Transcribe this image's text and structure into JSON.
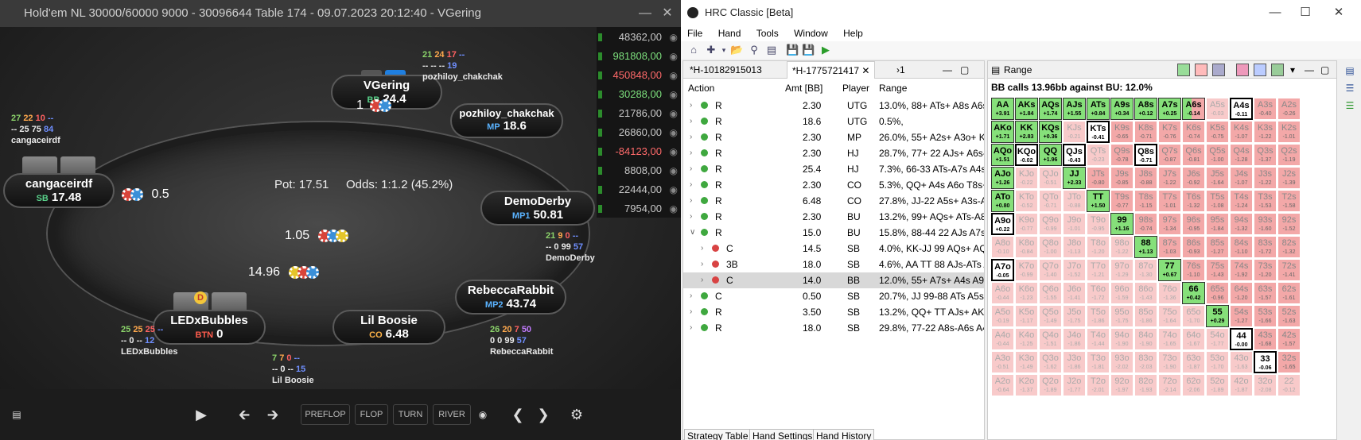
{
  "poker": {
    "title": "Hold'em NL 30000/60000 9000 - 30096644 Table 174 - 09.07.2023 20:12:40 - VGering",
    "pot": "Pot:  17.51",
    "odds": "Odds:  1:1.2 (45.2%)",
    "hero_cards": [
      "K",
      "7"
    ],
    "seats": {
      "vgering": {
        "name": "VGering",
        "pos": "BB",
        "stack": "24.4"
      },
      "pozhiloy": {
        "name": "pozhiloy_chakchak",
        "pos": "MP",
        "stack": "18.6"
      },
      "demoderby": {
        "name": "DemoDerby",
        "pos": "MP1",
        "stack": "50.81"
      },
      "rebecca": {
        "name": "RebeccaRabbit",
        "pos": "MP2",
        "stack": "43.74"
      },
      "boosie": {
        "name": "Lil Boosie",
        "pos": "CO",
        "stack": "6.48"
      },
      "ledx": {
        "name": "LEDxBubbles",
        "pos": "BTN",
        "stack": "0"
      },
      "cang": {
        "name": "cangaceirdf",
        "pos": "SB",
        "stack": "17.48"
      }
    },
    "bets": {
      "vgering": "1",
      "cang": "0.5",
      "center": "1.05",
      "ledx": "14.96"
    },
    "stats": {
      "pozhiloy": {
        "a": "21",
        "b": "24",
        "c": "17",
        "d": "--",
        "e": "-- --",
        "f": "--",
        "g": "19",
        "name": "pozhiloy_chakchak"
      },
      "cang": {
        "a": "27",
        "b": "22",
        "c": "10",
        "d": "--",
        "e": "-- 25",
        "f": "75",
        "g": "84",
        "name": "cangaceirdf"
      },
      "demoderby": {
        "a": "21",
        "b": "9",
        "c": "0",
        "d": "--",
        "e": "-- 0",
        "f": "99",
        "g": "57",
        "name": "DemoDerby"
      },
      "rebecca": {
        "a": "26",
        "b": "20",
        "c": "7",
        "d": "50",
        "e": "0 0",
        "f": "99",
        "g": "57",
        "name": "RebeccaRabbit"
      },
      "ledx": {
        "a": "25",
        "b": "25",
        "c": "25",
        "d": "--",
        "e": "-- 0",
        "f": "--",
        "g": "12",
        "name": "LEDxBubbles"
      },
      "boosie": {
        "a": "7",
        "b": "7",
        "c": "0",
        "d": "--",
        "e": "-- 0",
        "f": "--",
        "g": "15",
        "name": "Lil Boosie"
      }
    },
    "results": [
      "48362,00",
      "981808,00",
      "450848,00",
      "30288,00",
      "21786,00",
      "26860,00",
      "-84123,00",
      "8808,00",
      "22444,00",
      "7954,00"
    ],
    "results_colors": [
      "#c8c8c8",
      "#7de07d",
      "#ff6a6a",
      "#7de07d",
      "#c8c8c8",
      "#c8c8c8",
      "#ff6a6a",
      "#c8c8c8",
      "#c8c8c8",
      "#c8c8c8"
    ],
    "controls": {
      "preflop": "PREFLOP",
      "flop": "FLOP",
      "turn": "TURN",
      "river": "RIVER"
    },
    "dealer_button": "D"
  },
  "hrc": {
    "title": "HRC Classic [Beta]",
    "menu": [
      "File",
      "Hand",
      "Tools",
      "Window",
      "Help"
    ],
    "tabs": [
      "*H-10182915013",
      "*H-1775721417",
      "›1"
    ],
    "range_tab": "Range",
    "columns": {
      "action": "Action",
      "amt": "Amt [BB]",
      "player": "Player",
      "range": "Range"
    },
    "rows": [
      {
        "act": "R",
        "amt": "2.30",
        "pl": "UTG",
        "rng": "13.0%, 88+ ATs+ A8s A6s-A",
        "dot": "g",
        "indent": 0
      },
      {
        "act": "R",
        "amt": "18.6",
        "pl": "UTG",
        "rng": "0.5%,",
        "dot": "g",
        "indent": 0
      },
      {
        "act": "R",
        "amt": "2.30",
        "pl": "MP",
        "rng": "26.0%, 55+ A2s+ A3o+ K9s",
        "dot": "g",
        "indent": 0
      },
      {
        "act": "R",
        "amt": "2.30",
        "pl": "HJ",
        "rng": "28.7%, 77+ 22 AJs+ A6s-A5",
        "dot": "g",
        "indent": 0
      },
      {
        "act": "R",
        "amt": "25.4",
        "pl": "HJ",
        "rng": "7.3%, 66-33 ATs-A7s A4s-A",
        "dot": "g",
        "indent": 0
      },
      {
        "act": "R",
        "amt": "2.30",
        "pl": "CO",
        "rng": "5.3%, QQ+ A4s A6o T8s+ 9",
        "dot": "g",
        "indent": 0
      },
      {
        "act": "R",
        "amt": "6.48",
        "pl": "CO",
        "rng": "27.8%, JJ-22 A5s+ A3s-A2s",
        "dot": "g",
        "indent": 0
      },
      {
        "act": "R",
        "amt": "2.30",
        "pl": "BU",
        "rng": "13.2%, 99+ AQs+ ATs-A8s /",
        "dot": "g",
        "indent": 0
      },
      {
        "act": "R",
        "amt": "15.0",
        "pl": "BU",
        "rng": "15.8%, 88-44 22 AJs A7s-A2",
        "dot": "g",
        "indent": 0,
        "open": true
      },
      {
        "act": "C",
        "amt": "14.5",
        "pl": "SB",
        "rng": "4.0%, KK-JJ 99 AQs+ AQo-",
        "dot": "r",
        "indent": 1
      },
      {
        "act": "3B",
        "amt": "18.0",
        "pl": "SB",
        "rng": "4.6%, AA TT 88 AJs-ATs AK",
        "dot": "r",
        "indent": 1
      },
      {
        "act": "C",
        "amt": "14.0",
        "pl": "BB",
        "rng": "12.0%, 55+ A7s+ A4s A9o+",
        "dot": "r",
        "indent": 1,
        "sel": true
      },
      {
        "act": "C",
        "amt": "0.50",
        "pl": "SB",
        "rng": "20.7%, JJ 99-88 ATs A5s KJs",
        "dot": "g",
        "indent": 0
      },
      {
        "act": "R",
        "amt": "3.50",
        "pl": "SB",
        "rng": "13.2%, QQ+ TT AJs+ AKo K",
        "dot": "g",
        "indent": 0
      },
      {
        "act": "R",
        "amt": "18.0",
        "pl": "SB",
        "rng": "29.8%, 77-22 A8s-A6s A4s-",
        "dot": "g",
        "indent": 0
      }
    ],
    "range_title": "BB calls 13.96bb against BU: 12.0%",
    "bottom_tabs": [
      "Strategy Table",
      "Hand Settings",
      "Hand History"
    ],
    "grid": [
      [
        [
          "AA",
          "+3.91",
          "call"
        ],
        [
          "AKs",
          "+1.84",
          "call"
        ],
        [
          "AQs",
          "+1.74",
          "call"
        ],
        [
          "AJs",
          "+1.55",
          "call"
        ],
        [
          "ATs",
          "+0.84",
          "call"
        ],
        [
          "A9s",
          "+0.34",
          "call"
        ],
        [
          "A8s",
          "+0.12",
          "call"
        ],
        [
          "A7s",
          "+0.25",
          "call"
        ],
        [
          "A6s",
          "-0.14",
          "mixed"
        ],
        [
          "A5s",
          "-0.03",
          "pale"
        ],
        [
          "A4s",
          "-0.11",
          "boxed"
        ],
        [
          "A3s",
          "-0.40",
          "fold"
        ],
        [
          "A2s",
          "-0.26",
          "fold"
        ]
      ],
      [
        [
          "AKo",
          "+1.71",
          "call"
        ],
        [
          "KK",
          "+2.83",
          "call"
        ],
        [
          "KQs",
          "+0.36",
          "call"
        ],
        [
          "KJs",
          "-0.21",
          "pale"
        ],
        [
          "KTs",
          "-0.41",
          "boxed"
        ],
        [
          "K9s",
          "-0.65",
          "fold"
        ],
        [
          "K8s",
          "-0.71",
          "fold"
        ],
        [
          "K7s",
          "-0.76",
          "fold"
        ],
        [
          "K6s",
          "-0.74",
          "fold"
        ],
        [
          "K5s",
          "-0.75",
          "fold"
        ],
        [
          "K4s",
          "-1.07",
          "fold"
        ],
        [
          "K3s",
          "-1.22",
          "fold"
        ],
        [
          "K2s",
          "-1.01",
          "fold"
        ]
      ],
      [
        [
          "AQo",
          "+1.51",
          "call"
        ],
        [
          "KQo",
          "-0.02",
          "boxed"
        ],
        [
          "QQ",
          "+1.96",
          "call"
        ],
        [
          "QJs",
          "-0.43",
          "boxed"
        ],
        [
          "QTs",
          "-0.23",
          "pale"
        ],
        [
          "Q9s",
          "-0.78",
          "fold"
        ],
        [
          "Q8s",
          "-0.71",
          "boxed"
        ],
        [
          "Q7s",
          "-0.87",
          "fold"
        ],
        [
          "Q6s",
          "-0.81",
          "fold"
        ],
        [
          "Q5s",
          "-1.00",
          "fold"
        ],
        [
          "Q4s",
          "-1.28",
          "fold"
        ],
        [
          "Q3s",
          "-1.37",
          "fold"
        ],
        [
          "Q2s",
          "-1.19",
          "fold"
        ]
      ],
      [
        [
          "AJo",
          "+1.26",
          "call"
        ],
        [
          "KJo",
          "-0.22",
          "pale"
        ],
        [
          "QJo",
          "-0.51",
          "pale"
        ],
        [
          "JJ",
          "+2.33",
          "call"
        ],
        [
          "JTs",
          "-0.80",
          "fold"
        ],
        [
          "J9s",
          "-0.85",
          "fold"
        ],
        [
          "J8s",
          "-0.88",
          "fold"
        ],
        [
          "J7s",
          "-1.22",
          "fold"
        ],
        [
          "J6s",
          "-0.92",
          "fold"
        ],
        [
          "J5s",
          "-1.64",
          "fold"
        ],
        [
          "J4s",
          "-1.07",
          "fold"
        ],
        [
          "J3s",
          "-1.22",
          "fold"
        ],
        [
          "J2s",
          "-1.39",
          "fold"
        ]
      ],
      [
        [
          "ATo",
          "+0.80",
          "call"
        ],
        [
          "KTo",
          "-0.52",
          "pale"
        ],
        [
          "QTo",
          "-0.71",
          "pale"
        ],
        [
          "JTo",
          "-0.88",
          "pale"
        ],
        [
          "TT",
          "+1.50",
          "call"
        ],
        [
          "T9s",
          "-0.77",
          "fold"
        ],
        [
          "T8s",
          "-1.15",
          "fold"
        ],
        [
          "T7s",
          "-1.01",
          "fold"
        ],
        [
          "T6s",
          "-1.32",
          "fold"
        ],
        [
          "T5s",
          "-1.08",
          "fold"
        ],
        [
          "T4s",
          "-1.24",
          "fold"
        ],
        [
          "T3s",
          "-1.53",
          "fold"
        ],
        [
          "T2s",
          "-1.58",
          "fold"
        ]
      ],
      [
        [
          "A9o",
          "+0.22",
          "boxed"
        ],
        [
          "K9o",
          "-0.77",
          "pale"
        ],
        [
          "Q9o",
          "-0.99",
          "pale"
        ],
        [
          "J9o",
          "-1.01",
          "pale"
        ],
        [
          "T9o",
          "-0.95",
          "pale"
        ],
        [
          "99",
          "+1.16",
          "call"
        ],
        [
          "98s",
          "-0.74",
          "fold"
        ],
        [
          "97s",
          "-1.34",
          "fold"
        ],
        [
          "96s",
          "-0.95",
          "fold"
        ],
        [
          "95s",
          "-1.84",
          "fold"
        ],
        [
          "94s",
          "-1.32",
          "fold"
        ],
        [
          "93s",
          "-1.60",
          "fold"
        ],
        [
          "92s",
          "-1.52",
          "fold"
        ]
      ],
      [
        [
          "A8o",
          "-0.10",
          "pale"
        ],
        [
          "K8o",
          "-0.84",
          "pale"
        ],
        [
          "Q8o",
          "-1.00",
          "pale"
        ],
        [
          "J8o",
          "-1.13",
          "pale"
        ],
        [
          "T8o",
          "-1.20",
          "pale"
        ],
        [
          "98o",
          "-1.22",
          "pale"
        ],
        [
          "88",
          "+1.13",
          "call"
        ],
        [
          "87s",
          "-1.03",
          "fold"
        ],
        [
          "86s",
          "-0.93",
          "fold"
        ],
        [
          "85s",
          "-1.27",
          "fold"
        ],
        [
          "84s",
          "-1.10",
          "fold"
        ],
        [
          "83s",
          "-1.72",
          "fold"
        ],
        [
          "82s",
          "-1.32",
          "fold"
        ]
      ],
      [
        [
          "A7o",
          "-0.05",
          "boxed"
        ],
        [
          "K7o",
          "-0.99",
          "pale"
        ],
        [
          "Q7o",
          "-1.40",
          "pale"
        ],
        [
          "J7o",
          "-1.52",
          "pale"
        ],
        [
          "T7o",
          "-1.21",
          "pale"
        ],
        [
          "97o",
          "-1.29",
          "pale"
        ],
        [
          "87o",
          "-1.30",
          "pale"
        ],
        [
          "77",
          "+0.67",
          "call"
        ],
        [
          "76s",
          "-1.10",
          "fold"
        ],
        [
          "75s",
          "-1.43",
          "fold"
        ],
        [
          "74s",
          "-1.92",
          "fold"
        ],
        [
          "73s",
          "-1.20",
          "fold"
        ],
        [
          "72s",
          "-1.41",
          "fold"
        ]
      ],
      [
        [
          "A6o",
          "-0.44",
          "pale"
        ],
        [
          "K6o",
          "-1.23",
          "pale"
        ],
        [
          "Q6o",
          "-1.55",
          "pale"
        ],
        [
          "J6o",
          "-1.41",
          "pale"
        ],
        [
          "T6o",
          "-1.72",
          "pale"
        ],
        [
          "96o",
          "-1.59",
          "pale"
        ],
        [
          "86o",
          "-1.43",
          "pale"
        ],
        [
          "76o",
          "-1.36",
          "pale"
        ],
        [
          "66",
          "+0.42",
          "call"
        ],
        [
          "65s",
          "-0.96",
          "fold"
        ],
        [
          "64s",
          "-1.20",
          "fold"
        ],
        [
          "63s",
          "-1.57",
          "fold"
        ],
        [
          "62s",
          "-1.61",
          "fold"
        ]
      ],
      [
        [
          "A5o",
          "-0.19",
          "pale"
        ],
        [
          "K5o",
          "-1.17",
          "pale"
        ],
        [
          "Q5o",
          "-1.49",
          "pale"
        ],
        [
          "J5o",
          "-1.75",
          "pale"
        ],
        [
          "T5o",
          "-1.86",
          "pale"
        ],
        [
          "95o",
          "-1.75",
          "pale"
        ],
        [
          "85o",
          "-1.86",
          "pale"
        ],
        [
          "75o",
          "-1.64",
          "pale"
        ],
        [
          "65o",
          "-1.70",
          "pale"
        ],
        [
          "55",
          "+0.29",
          "call"
        ],
        [
          "54s",
          "-1.27",
          "fold"
        ],
        [
          "53s",
          "-1.66",
          "fold"
        ],
        [
          "52s",
          "-1.63",
          "fold"
        ]
      ],
      [
        [
          "A4o",
          "-0.44",
          "pale"
        ],
        [
          "K4o",
          "-1.25",
          "pale"
        ],
        [
          "Q4o",
          "-1.51",
          "pale"
        ],
        [
          "J4o",
          "-1.86",
          "pale"
        ],
        [
          "T4o",
          "-1.44",
          "pale"
        ],
        [
          "94o",
          "-1.90",
          "pale"
        ],
        [
          "84o",
          "-1.90",
          "pale"
        ],
        [
          "74o",
          "-1.65",
          "pale"
        ],
        [
          "64o",
          "-1.67",
          "pale"
        ],
        [
          "54o",
          "-1.77",
          "pale"
        ],
        [
          "44",
          "-0.00",
          "boxed"
        ],
        [
          "43s",
          "-1.68",
          "fold"
        ],
        [
          "42s",
          "-1.57",
          "fold"
        ]
      ],
      [
        [
          "A3o",
          "-0.51",
          "pale"
        ],
        [
          "K3o",
          "-1.49",
          "pale"
        ],
        [
          "Q3o",
          "-1.62",
          "pale"
        ],
        [
          "J3o",
          "-1.86",
          "pale"
        ],
        [
          "T3o",
          "-1.81",
          "pale"
        ],
        [
          "93o",
          "-2.02",
          "pale"
        ],
        [
          "83o",
          "-2.03",
          "pale"
        ],
        [
          "73o",
          "-1.90",
          "pale"
        ],
        [
          "63o",
          "-1.87",
          "pale"
        ],
        [
          "53o",
          "-1.70",
          "pale"
        ],
        [
          "43o",
          "-1.63",
          "pale"
        ],
        [
          "33",
          "-0.06",
          "boxed"
        ],
        [
          "32s",
          "-1.65",
          "fold"
        ]
      ],
      [
        [
          "A2o",
          "-0.64",
          "pale"
        ],
        [
          "K2o",
          "-1.37",
          "pale"
        ],
        [
          "Q2o",
          "-1.89",
          "pale"
        ],
        [
          "J2o",
          "-1.77",
          "pale"
        ],
        [
          "T2o",
          "-2.01",
          "pale"
        ],
        [
          "92o",
          "-1.97",
          "pale"
        ],
        [
          "82o",
          "-1.93",
          "pale"
        ],
        [
          "72o",
          "-2.14",
          "pale"
        ],
        [
          "62o",
          "-2.06",
          "pale"
        ],
        [
          "52o",
          "-1.89",
          "pale"
        ],
        [
          "42o",
          "-1.87",
          "pale"
        ],
        [
          "32o",
          "-2.08",
          "pale"
        ],
        [
          "22",
          "-0.12",
          "pale"
        ]
      ]
    ]
  }
}
